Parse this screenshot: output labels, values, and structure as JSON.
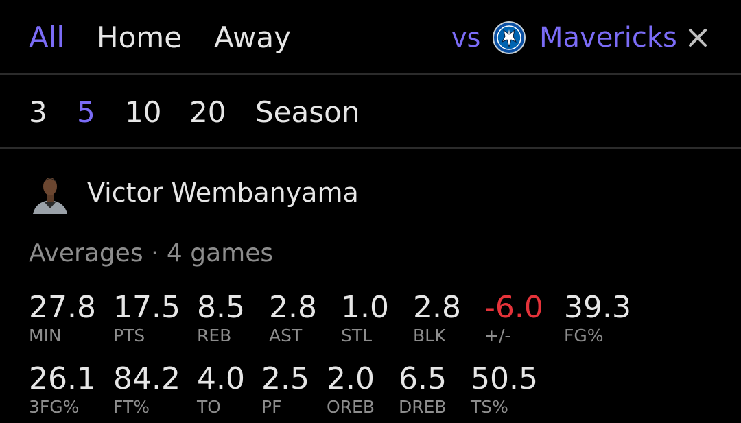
{
  "filters": {
    "location_tabs": [
      "All",
      "Home",
      "Away"
    ],
    "active_location": "All",
    "opponent": {
      "prefix": "vs",
      "team": "Mavericks",
      "logo_icon": "mavericks-logo",
      "clear_icon": "close-icon"
    },
    "ranges": [
      "3",
      "5",
      "10",
      "20",
      "Season"
    ],
    "active_range": "5"
  },
  "player": {
    "name": "Victor Wembanyama",
    "avatar_icon": "player-headshot"
  },
  "averages_label": "Averages · 4 games",
  "stats_row1": [
    {
      "value": "27.8",
      "label": "MIN"
    },
    {
      "value": "17.5",
      "label": "PTS"
    },
    {
      "value": "8.5",
      "label": "REB"
    },
    {
      "value": "2.8",
      "label": "AST"
    },
    {
      "value": "1.0",
      "label": "STL"
    },
    {
      "value": "2.8",
      "label": "BLK"
    },
    {
      "value": "-6.0",
      "label": "+/-"
    },
    {
      "value": "39.3",
      "label": "FG%"
    }
  ],
  "stats_row2": [
    {
      "value": "26.1",
      "label": "3FG%"
    },
    {
      "value": "84.2",
      "label": "FT%"
    },
    {
      "value": "4.0",
      "label": "TO"
    },
    {
      "value": "2.5",
      "label": "PF"
    },
    {
      "value": "2.0",
      "label": "OREB"
    },
    {
      "value": "6.5",
      "label": "DREB"
    },
    {
      "value": "50.5",
      "label": "TS%"
    }
  ],
  "colors": {
    "background": "#000000",
    "accent": "#7b6cf6",
    "text": "#e6e6e6",
    "muted": "#8d8d8d",
    "negative": "#e5333a",
    "divider": "#2b2b2b"
  }
}
